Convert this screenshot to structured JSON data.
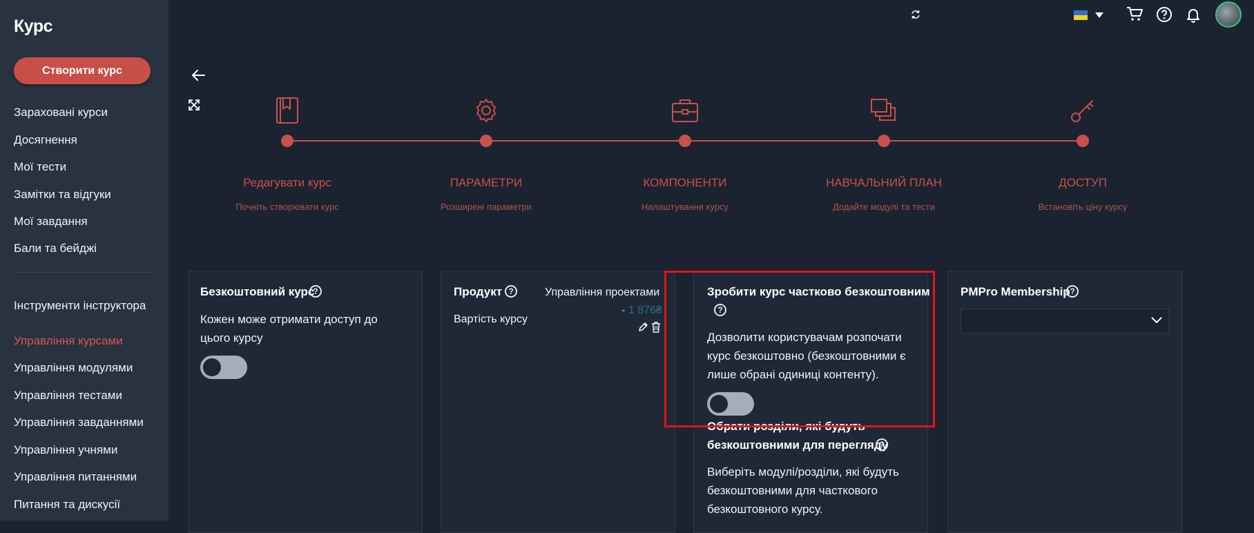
{
  "sidebar": {
    "brand": "Курс",
    "create_button": "Створити курс",
    "items": [
      {
        "label": "Зараховані курси"
      },
      {
        "label": "Досягнення"
      },
      {
        "label": "Мої тести"
      },
      {
        "label": "Замітки та відгуки"
      },
      {
        "label": "Мої завдання"
      },
      {
        "label": "Бали та бейджі"
      }
    ],
    "section_title": "Інструменти інструктора",
    "instructor_items": [
      {
        "label": "Управління курсами",
        "active": true
      },
      {
        "label": "Управління модулями"
      },
      {
        "label": "Управління тестами"
      },
      {
        "label": "Управління завданнями"
      },
      {
        "label": "Управління учнями"
      },
      {
        "label": "Управління питаннями"
      },
      {
        "label": "Питання та дискусії"
      }
    ]
  },
  "topbar": {
    "icons": [
      "sync-icon",
      "ukraine-flag-icon",
      "dropdown-caret-icon",
      "cart-icon",
      "help-icon",
      "bell-icon",
      "avatar"
    ]
  },
  "stepper": {
    "steps": [
      {
        "title": "Редагувати курс",
        "subtitle": "Почніть створювати курс",
        "icon": "bookmark-book-icon"
      },
      {
        "title": "ПАРАМЕТРИ",
        "subtitle": "Розширені параметри",
        "icon": "gear-icon"
      },
      {
        "title": "КОМПОНЕНТИ",
        "subtitle": "Налаштування курсу",
        "icon": "briefcase-icon"
      },
      {
        "title": "НАВЧАЛЬНИЙ ПЛАН",
        "subtitle": "Додайте модулі та тести",
        "icon": "layers-icon"
      },
      {
        "title": "ДОСТУП",
        "subtitle": "Встановіть ціну курсу",
        "icon": "key-icon"
      }
    ]
  },
  "cards": {
    "free_course": {
      "title": "Безкоштовний курс",
      "description": "Кожен може отримати доступ до цього курсу",
      "toggle_on": false
    },
    "product": {
      "title": "Продукт",
      "product_name": "Управління проектами",
      "price_prefix": "-",
      "price": "1 876₴",
      "course_cost_label": "Вартість курсу"
    },
    "partial_free": {
      "title": "Зробити курс частково безкоштовним",
      "description": "Дозволити користувачам розпочати курс безкоштовно (безкоштовними є лише обрані одиниці контенту).",
      "toggle_on": false,
      "sections_title": "Обрати розділи, які будуть безкоштовними для перегляду",
      "sections_description": "Виберіть модулі/розділи, які будуть безкоштовними для часткового безкоштовного курсу."
    },
    "pmpro": {
      "title": "PMPro Membership",
      "selected_value": ""
    }
  },
  "colors": {
    "accent": "#c84e4a",
    "background": "#1c2330",
    "sidebar": "#283240",
    "highlight": "#e1141a"
  }
}
